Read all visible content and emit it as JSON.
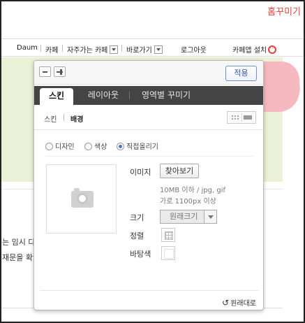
{
  "header": {
    "brand": "홈꾸미기"
  },
  "topnav": {
    "daum": "Daum",
    "cafe": "카페",
    "frequent_cafe": "자주가는 카페",
    "shortcut": "바로가기",
    "logout": "로그아웃",
    "cafe_app": "카페앱 설치"
  },
  "background": {
    "line1": "는 임시 다",
    "line2": "재문을 확인"
  },
  "panel": {
    "apply_label": "적용",
    "tabs": [
      {
        "label": "스킨",
        "active": true
      },
      {
        "label": "레이아웃",
        "active": false
      },
      {
        "label": "영역별 꾸미기",
        "active": false
      }
    ],
    "subtabs": [
      {
        "label": "스킨",
        "active": false
      },
      {
        "label": "배경",
        "active": true
      }
    ],
    "radios": [
      {
        "label": "디자인",
        "selected": false
      },
      {
        "label": "색상",
        "selected": false
      },
      {
        "label": "직접올리기",
        "selected": true
      }
    ],
    "image": {
      "label": "이미지",
      "find_button": "찾아보기",
      "note1": "10MB 이하 / jpg, gif",
      "note2": "가로 1100px 이상"
    },
    "size": {
      "label": "크기",
      "selected": "원래크기"
    },
    "align": {
      "label": "정렬"
    },
    "bgcolor": {
      "label": "바탕색"
    },
    "reset_label": "원래대로"
  },
  "colors": {
    "brand": "#e2423a",
    "accent": "#4a6fd1",
    "tab_bar": "#444444",
    "green_bg": "#e9f1d6",
    "pink": "#f7b9c0"
  }
}
